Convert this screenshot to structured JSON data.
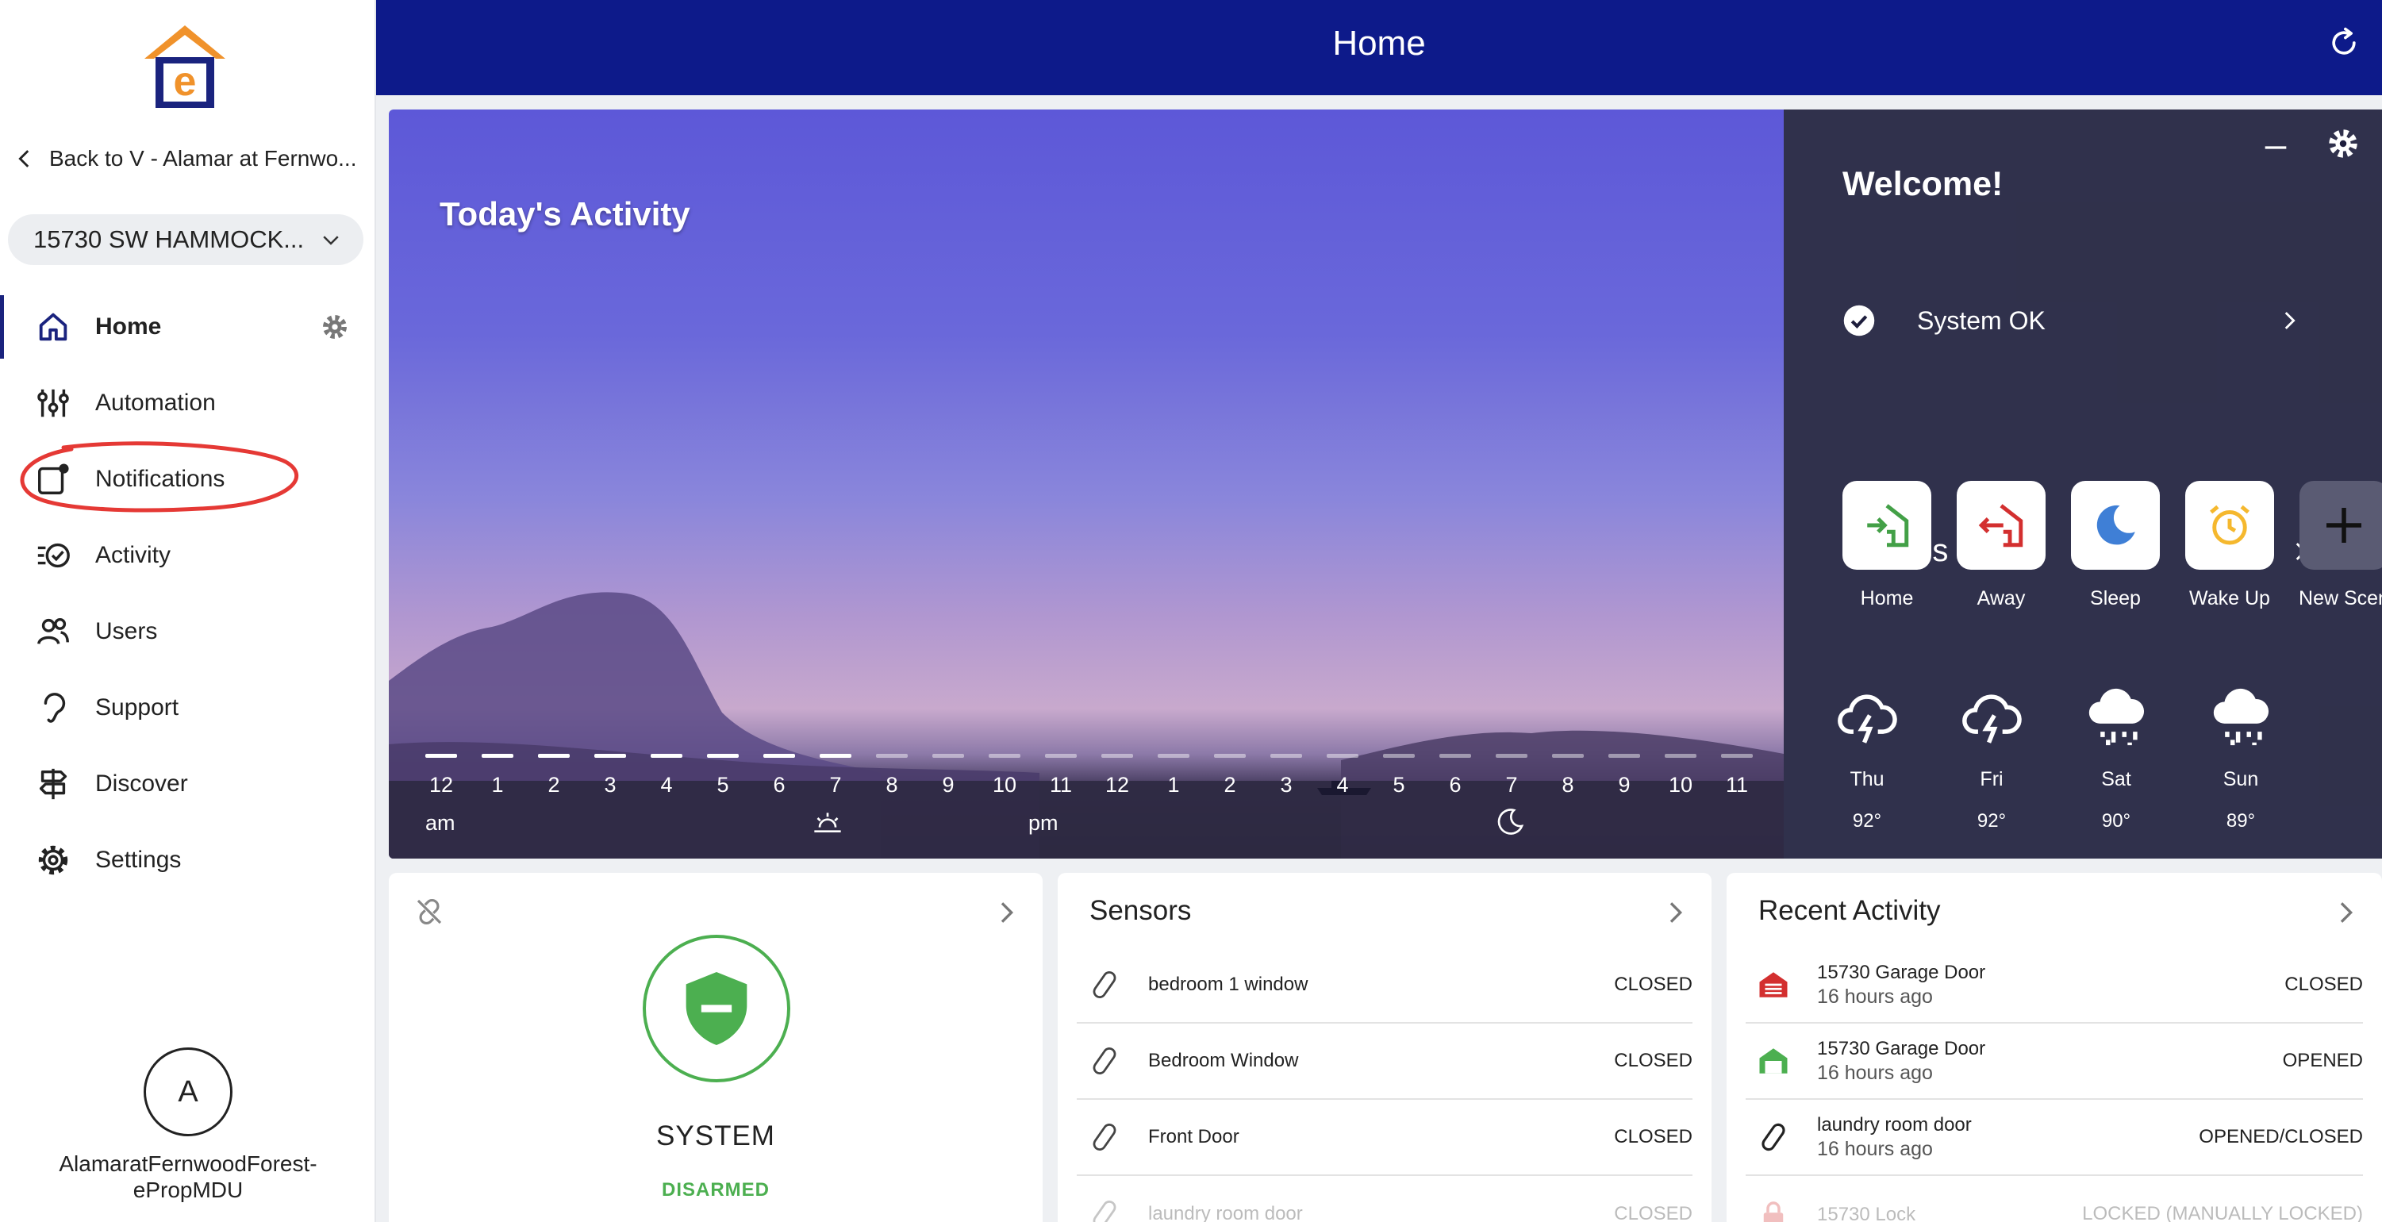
{
  "sidebar": {
    "back_label": "Back to V - Alamar at Fernwo...",
    "property": "15730 SW HAMMOCK...",
    "nav": [
      {
        "label": "Home"
      },
      {
        "label": "Automation"
      },
      {
        "label": "Notifications"
      },
      {
        "label": "Activity"
      },
      {
        "label": "Users"
      },
      {
        "label": "Support"
      },
      {
        "label": "Discover"
      },
      {
        "label": "Settings"
      }
    ],
    "user": {
      "initial": "A",
      "name_line1": "AlamaratFernwoodForest-",
      "name_line2": "ePropMDU"
    }
  },
  "header": {
    "title": "Home"
  },
  "activity": {
    "title": "Today's Activity",
    "hours": [
      "12",
      "1",
      "2",
      "3",
      "4",
      "5",
      "6",
      "7",
      "8",
      "9",
      "10",
      "11",
      "12",
      "1",
      "2",
      "3",
      "4",
      "5",
      "6",
      "7",
      "8",
      "9",
      "10",
      "11"
    ],
    "elapsed_hours": 8,
    "am_label": "am",
    "pm_label": "pm"
  },
  "welcome": {
    "title": "Welcome!",
    "status": "System OK",
    "scenes_title": "Scenes",
    "scenes": [
      {
        "label": "Home",
        "icon": "home-arrive-icon"
      },
      {
        "label": "Away",
        "icon": "home-leave-icon"
      },
      {
        "label": "Sleep",
        "icon": "moon-icon"
      },
      {
        "label": "Wake Up",
        "icon": "alarm-clock-icon"
      },
      {
        "label": "New Scen",
        "icon": "plus-icon"
      }
    ],
    "weather": [
      {
        "day": "Thu",
        "temp": "92°",
        "icon": "thunderstorm-icon"
      },
      {
        "day": "Fri",
        "temp": "92°",
        "icon": "thunderstorm-icon"
      },
      {
        "day": "Sat",
        "temp": "90°",
        "icon": "rain-icon"
      },
      {
        "day": "Sun",
        "temp": "89°",
        "icon": "rain-icon"
      }
    ]
  },
  "system": {
    "label": "SYSTEM",
    "state": "DISARMED",
    "state_color": "#4caf50"
  },
  "sensors": {
    "title": "Sensors",
    "items": [
      {
        "name": "bedroom 1 window",
        "state": "CLOSED"
      },
      {
        "name": "Bedroom Window",
        "state": "CLOSED"
      },
      {
        "name": "Front Door",
        "state": "CLOSED"
      },
      {
        "name": "laundry room door",
        "state": "CLOSED"
      }
    ]
  },
  "recent": {
    "title": "Recent Activity",
    "items": [
      {
        "name": "15730 Garage Door",
        "time": "16 hours ago",
        "state": "CLOSED",
        "icon": "garage-closed-icon"
      },
      {
        "name": "15730 Garage Door",
        "time": "16 hours ago",
        "state": "OPENED",
        "icon": "garage-open-icon"
      },
      {
        "name": "laundry room door",
        "time": "16 hours ago",
        "state": "OPENED/CLOSED",
        "icon": "contact-sensor-icon"
      },
      {
        "name": "15730 Lock",
        "time": "",
        "state": "LOCKED (MANUALLY LOCKED)",
        "icon": "lock-icon"
      }
    ]
  },
  "colors": {
    "brand_navy": "#0d1a8a",
    "accent_orange": "#f0922b",
    "ok_green": "#4caf50",
    "alert_red": "#d32f2f",
    "annotation_red": "#e53935"
  }
}
